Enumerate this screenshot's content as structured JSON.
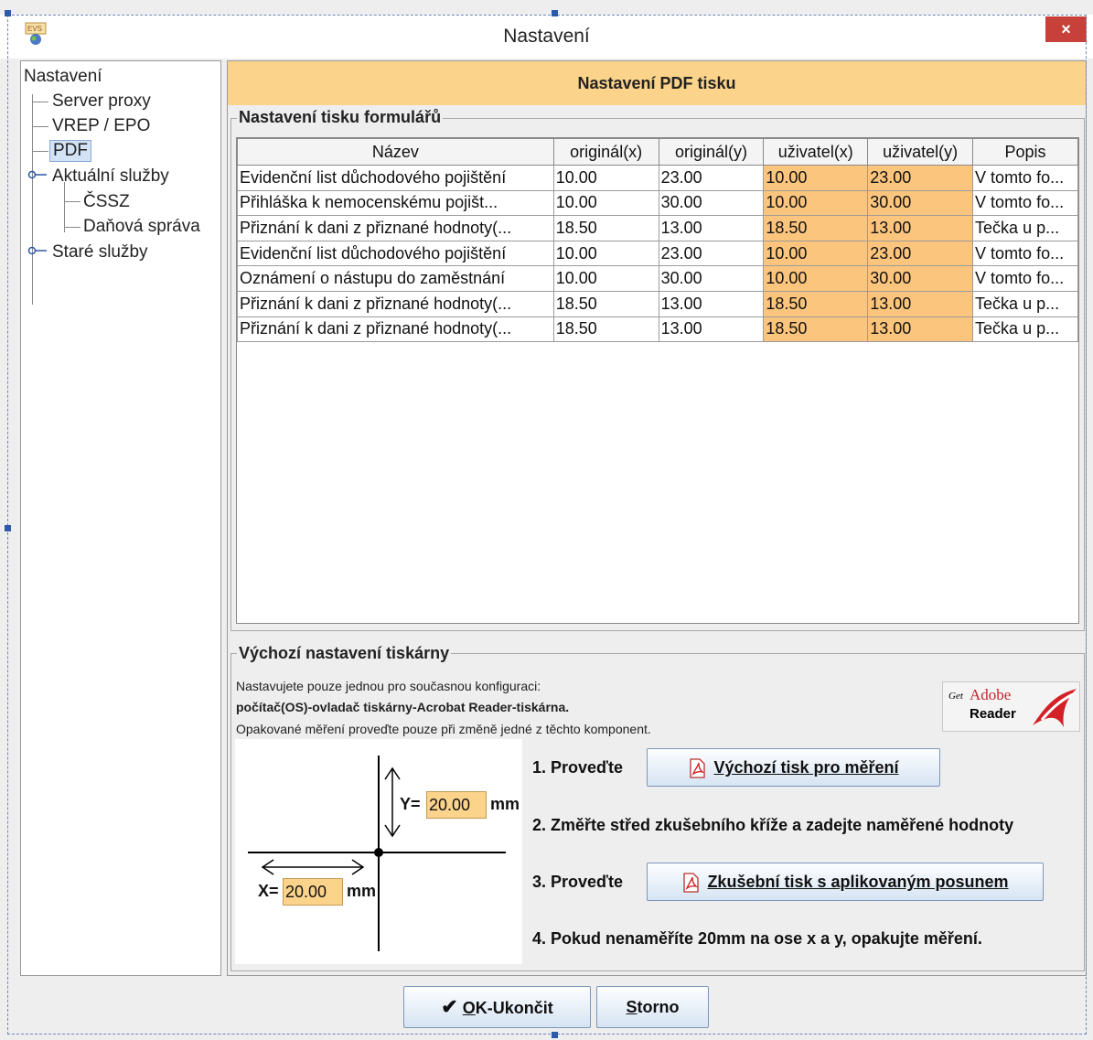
{
  "window": {
    "title": "Nastavení",
    "close_glyph": "×"
  },
  "tree": {
    "root": "Nastavení",
    "items": [
      {
        "label": "Server proxy"
      },
      {
        "label": "VREP / EPO"
      },
      {
        "label": "PDF"
      },
      {
        "label": "Aktuální služby"
      },
      {
        "label": "ČSSZ"
      },
      {
        "label": "Daňová správa"
      },
      {
        "label": "Staré služby"
      }
    ]
  },
  "main": {
    "header": "Nastavení PDF tisku",
    "forms_group_title": "Nastavení tisku formulářů",
    "table": {
      "columns": [
        "Název",
        "originál(x)",
        "originál(y)",
        "uživatel(x)",
        "uživatel(y)",
        "Popis"
      ],
      "rows": [
        [
          "Evidenční list důchodového pojištění",
          "10.00",
          "23.00",
          "10.00",
          "23.00",
          "V tomto fo..."
        ],
        [
          "Přihláška k nemocenskému pojišt...",
          "10.00",
          "30.00",
          "10.00",
          "30.00",
          "V tomto fo..."
        ],
        [
          "Přiznání k dani z přiznané hodnoty(...",
          "18.50",
          "13.00",
          "18.50",
          "13.00",
          "Tečka u p..."
        ],
        [
          "Evidenční list důchodového pojištění",
          "10.00",
          "23.00",
          "10.00",
          "23.00",
          "V tomto fo..."
        ],
        [
          "Oznámení o nástupu do zaměstnání",
          "10.00",
          "30.00",
          "10.00",
          "30.00",
          "V tomto fo..."
        ],
        [
          "Přiznání k dani z přiznané hodnoty(...",
          "18.50",
          "13.00",
          "18.50",
          "13.00",
          "Tečka u p..."
        ],
        [
          "Přiznání k dani z přiznané hodnoty(...",
          "18.50",
          "13.00",
          "18.50",
          "13.00",
          "Tečka u p..."
        ]
      ]
    },
    "printer_group_title": "Výchozí nastavení tiskárny",
    "info_line1": "Nastavujete pouze jednou pro současnou konfiguraci:",
    "info_line2": "počítač(OS)-ovladač tiskárny-Acrobat Reader-tiskárna.",
    "info_line3": "Opakované měření proveďte pouze při změně jedné z těchto komponent.",
    "adobe": {
      "get": "Get",
      "adobe": "Adobe",
      "reader": "Reader"
    },
    "diagram": {
      "y_label": "Y=",
      "y_value": "20.00",
      "y_unit": "mm",
      "x_label": "X=",
      "x_value": "20.00",
      "x_unit": "mm"
    },
    "step1": "1. Proveďte",
    "step1_button": "Výchozí tisk pro měření",
    "step2": "2. Změřte střed zkušebního kříže a zadejte naměřené hodnoty",
    "step3": "3. Proveďte",
    "step3_button": "Zkušební tisk s aplikovaným posunem",
    "step4": "4. Pokud nenaměříte 20mm na ose x a y, opakujte měření."
  },
  "footer": {
    "ok_underlined": "O",
    "ok_rest": "K-Ukončit",
    "cancel_underlined": "S",
    "cancel_rest": "torno"
  },
  "colors": {
    "header": "#fbd38a",
    "user_cell": "#fcc57d",
    "input": "#fcd38b",
    "close": "#c7413a"
  }
}
